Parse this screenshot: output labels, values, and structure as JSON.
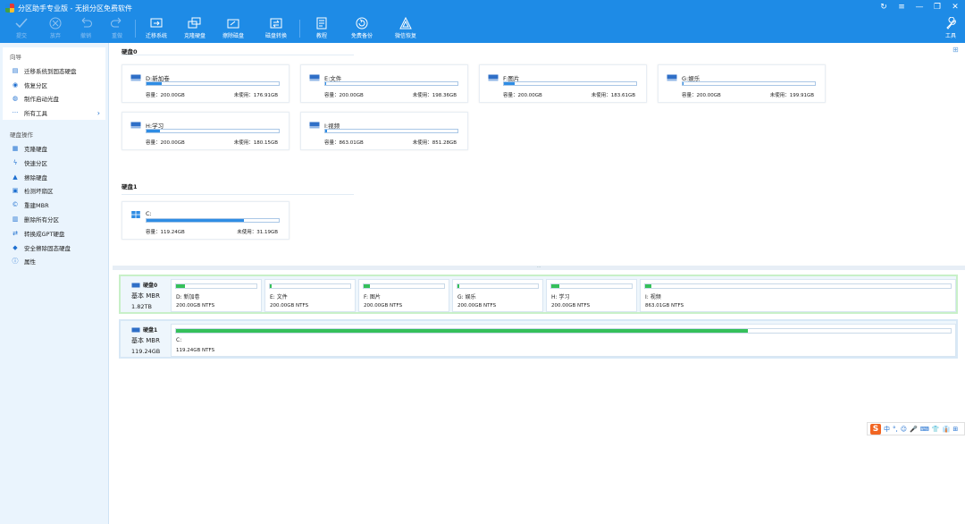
{
  "window": {
    "title": "分区助手专业版 - 无损分区免费软件",
    "controls": [
      "↻",
      "≡",
      "—",
      "❐",
      "✕"
    ]
  },
  "toolbar": {
    "items": [
      {
        "label": "提交",
        "icon": "check-icon",
        "disabled": true
      },
      {
        "label": "放弃",
        "icon": "cancel-icon",
        "disabled": true
      },
      {
        "label": "撤销",
        "icon": "undo-icon",
        "disabled": true
      },
      {
        "label": "重做",
        "icon": "redo-icon",
        "disabled": true
      },
      {
        "label": "迁移系统",
        "icon": "migrate-os-icon",
        "disabled": false
      },
      {
        "label": "克隆硬盘",
        "icon": "clone-disk-icon",
        "disabled": false
      },
      {
        "label": "擦除磁盘",
        "icon": "wipe-disk-icon",
        "disabled": false
      },
      {
        "label": "磁盘转换",
        "icon": "convert-disk-icon",
        "disabled": false
      },
      {
        "label": "教程",
        "icon": "tutorial-icon",
        "disabled": false
      },
      {
        "label": "免费备份",
        "icon": "backup-icon",
        "disabled": false
      },
      {
        "label": "微信恢复",
        "icon": "wechat-recovery-icon",
        "disabled": false
      }
    ],
    "tools_label": "工具"
  },
  "sidebar": {
    "wizard_title": "向导",
    "wizard_items": [
      {
        "label": "迁移系统到固态硬盘",
        "icon": "migrate-icon"
      },
      {
        "label": "恢复分区",
        "icon": "recover-icon"
      },
      {
        "label": "制作启动光盘",
        "icon": "boot-disc-icon"
      },
      {
        "label": "所有工具",
        "icon": "more-icon",
        "arrow": "›"
      }
    ],
    "disk_ops_title": "硬盘操作",
    "disk_ops_items": [
      {
        "label": "克隆硬盘",
        "icon": "clone-icon"
      },
      {
        "label": "快速分区",
        "icon": "quick-partition-icon"
      },
      {
        "label": "擦除硬盘",
        "icon": "wipe-icon"
      },
      {
        "label": "检测坏扇区",
        "icon": "bad-sector-icon"
      },
      {
        "label": "重建MBR",
        "icon": "rebuild-mbr-icon"
      },
      {
        "label": "删除所有分区",
        "icon": "delete-partitions-icon"
      },
      {
        "label": "转换成GPT硬盘",
        "icon": "convert-gpt-icon"
      },
      {
        "label": "安全擦除固态硬盘",
        "icon": "secure-erase-icon"
      },
      {
        "label": "属性",
        "icon": "info-icon"
      }
    ]
  },
  "disk0": {
    "title": "硬盘0",
    "cards": [
      {
        "name": "D:新加卷",
        "capacity": "容量：200.00GB",
        "free": "未使用：176.91GB",
        "used_fraction": 0.115
      },
      {
        "name": "E:文件",
        "capacity": "容量：200.00GB",
        "free": "未使用：198.36GB",
        "used_fraction": 0.008
      },
      {
        "name": "F:图片",
        "capacity": "容量：200.00GB",
        "free": "未使用：183.61GB",
        "used_fraction": 0.082
      },
      {
        "name": "G:娱乐",
        "capacity": "容量：200.00GB",
        "free": "未使用：199.91GB",
        "used_fraction": 0.004
      },
      {
        "name": "H:学习",
        "capacity": "容量：200.00GB",
        "free": "未使用：180.15GB",
        "used_fraction": 0.099
      },
      {
        "name": "I:视频",
        "capacity": "容量：863.01GB",
        "free": "未使用：851.28GB",
        "used_fraction": 0.014
      }
    ]
  },
  "disk1": {
    "title": "硬盘1",
    "cards": [
      {
        "name": "C:",
        "capacity": "容量：119.24GB",
        "free": "未使用：31.19GB",
        "used_fraction": 0.738
      }
    ]
  },
  "layout_view": {
    "splitter_glyph": "···",
    "disk0": {
      "name": "硬盘0",
      "type": "基本 MBR",
      "size": "1.82TB",
      "partitions": [
        {
          "name": "D: 新加卷",
          "size": "200.00GB NTFS",
          "used_fraction": 0.115
        },
        {
          "name": "E: 文件",
          "size": "200.00GB NTFS",
          "used_fraction": 0.008
        },
        {
          "name": "F: 图片",
          "size": "200.00GB NTFS",
          "used_fraction": 0.082
        },
        {
          "name": "G: 娱乐",
          "size": "200.00GB NTFS",
          "used_fraction": 0.004
        },
        {
          "name": "H: 学习",
          "size": "200.00GB NTFS",
          "used_fraction": 0.099
        },
        {
          "name": "I: 视频",
          "size": "863.01GB NTFS",
          "used_fraction": 0.014
        }
      ]
    },
    "disk1": {
      "name": "硬盘1",
      "type": "基本 MBR",
      "size": "119.24GB",
      "partitions": [
        {
          "name": "C:",
          "size": "119.24GB NTFS",
          "used_fraction": 0.738
        }
      ]
    }
  },
  "ime": {
    "logo": "S",
    "lang": "中",
    "items": [
      "°,",
      "☺",
      "🎤",
      "⌨",
      "👕",
      "👔",
      "⊞"
    ]
  },
  "colors": {
    "accent": "#1e8be6",
    "usage_bar": "#2f8de4",
    "partition_bar": "#35c05a"
  }
}
